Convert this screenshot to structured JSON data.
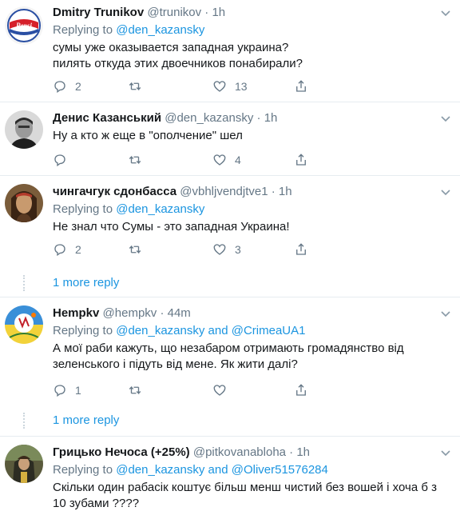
{
  "tweets": [
    {
      "name": "Dmitry Trunikov",
      "handle": "@trunikov",
      "dot": "·",
      "time": "1h",
      "replying_prefix": "Replying to",
      "replying_to": "@den_kazansky",
      "replying_and": "",
      "replying_to2": "",
      "text_lines": [
        "сумы уже оказывается западная украина?",
        "пилять откуда этих двоечников понабирали?"
      ],
      "replies": "2",
      "retweets": "",
      "likes": "13"
    },
    {
      "name": "Денис Казанський",
      "handle": "@den_kazansky",
      "dot": "·",
      "time": "1h",
      "text_lines": [
        "Ну а кто ж еще в \"ополчение\" шел"
      ],
      "replies": "",
      "retweets": "",
      "likes": "4"
    },
    {
      "name": "чингачгук сдонбасса",
      "handle": "@vbhljvendjtve1",
      "dot": "·",
      "time": "1h",
      "replying_prefix": "Replying to",
      "replying_to": "@den_kazansky",
      "text_lines": [
        "Не знал что Сумы - это западная Украина!"
      ],
      "replies": "2",
      "retweets": "",
      "likes": "3"
    },
    {
      "name": "Hempkv",
      "handle": "@hempkv",
      "dot": "·",
      "time": "44m",
      "replying_prefix": "Replying to",
      "replying_to": "@den_kazansky",
      "replying_and": "and",
      "replying_to2": "@CrimeaUA1",
      "text_lines": [
        "А мої раби кажуть, що незабаром отримають громадянство від",
        "зеленського і підуть від мене. Як жити далі?"
      ],
      "replies": "1",
      "retweets": "",
      "likes": ""
    },
    {
      "name": "Грицько Нечоса (+25%)",
      "handle": "@pitkovanabloha",
      "dot": "·",
      "time": "1h",
      "replying_prefix": "Replying to",
      "replying_to": "@den_kazansky",
      "replying_and": "and",
      "replying_to2": "@Oliver51576284",
      "text_lines": [
        "Скільки один рабасік коштує більш менш чистий без вошей і хоча б з",
        "10 зубами ????"
      ]
    }
  ],
  "more_reply_label": "1 more reply",
  "colors": {
    "link": "#1b95e0",
    "muted": "#657786",
    "border": "#e6ecf0"
  }
}
